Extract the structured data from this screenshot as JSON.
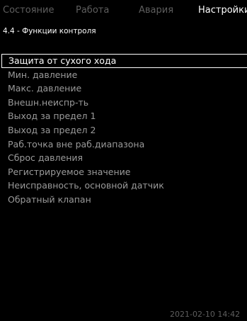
{
  "tabs": [
    {
      "label": "Состояние"
    },
    {
      "label": "Работа"
    },
    {
      "label": "Авария"
    },
    {
      "label": "Настройки"
    }
  ],
  "active_tab": "Настройки",
  "breadcrumb": "4.4 - Функции контроля",
  "menu": {
    "items": [
      {
        "label": "Защита от сухого хода",
        "selected": true
      },
      {
        "label": "Мин. давление"
      },
      {
        "label": "Макс. давление"
      },
      {
        "label": "Внешн.неиспр-ть"
      },
      {
        "label": "Выход за предел 1"
      },
      {
        "label": "Выход за предел 2"
      },
      {
        "label": "Раб.точка вне раб.диапазона"
      },
      {
        "label": "Сброс давления"
      },
      {
        "label": "Регистрируемое значение"
      },
      {
        "label": "Неисправность, основной датчик"
      },
      {
        "label": "Обратный клапан"
      }
    ]
  },
  "timestamp": "2021-02-10 14:42",
  "colors": {
    "background": "#000000",
    "active_text": "#ffffff",
    "inactive_text": "#5e5e5e",
    "item_text": "#9a9a9a"
  }
}
